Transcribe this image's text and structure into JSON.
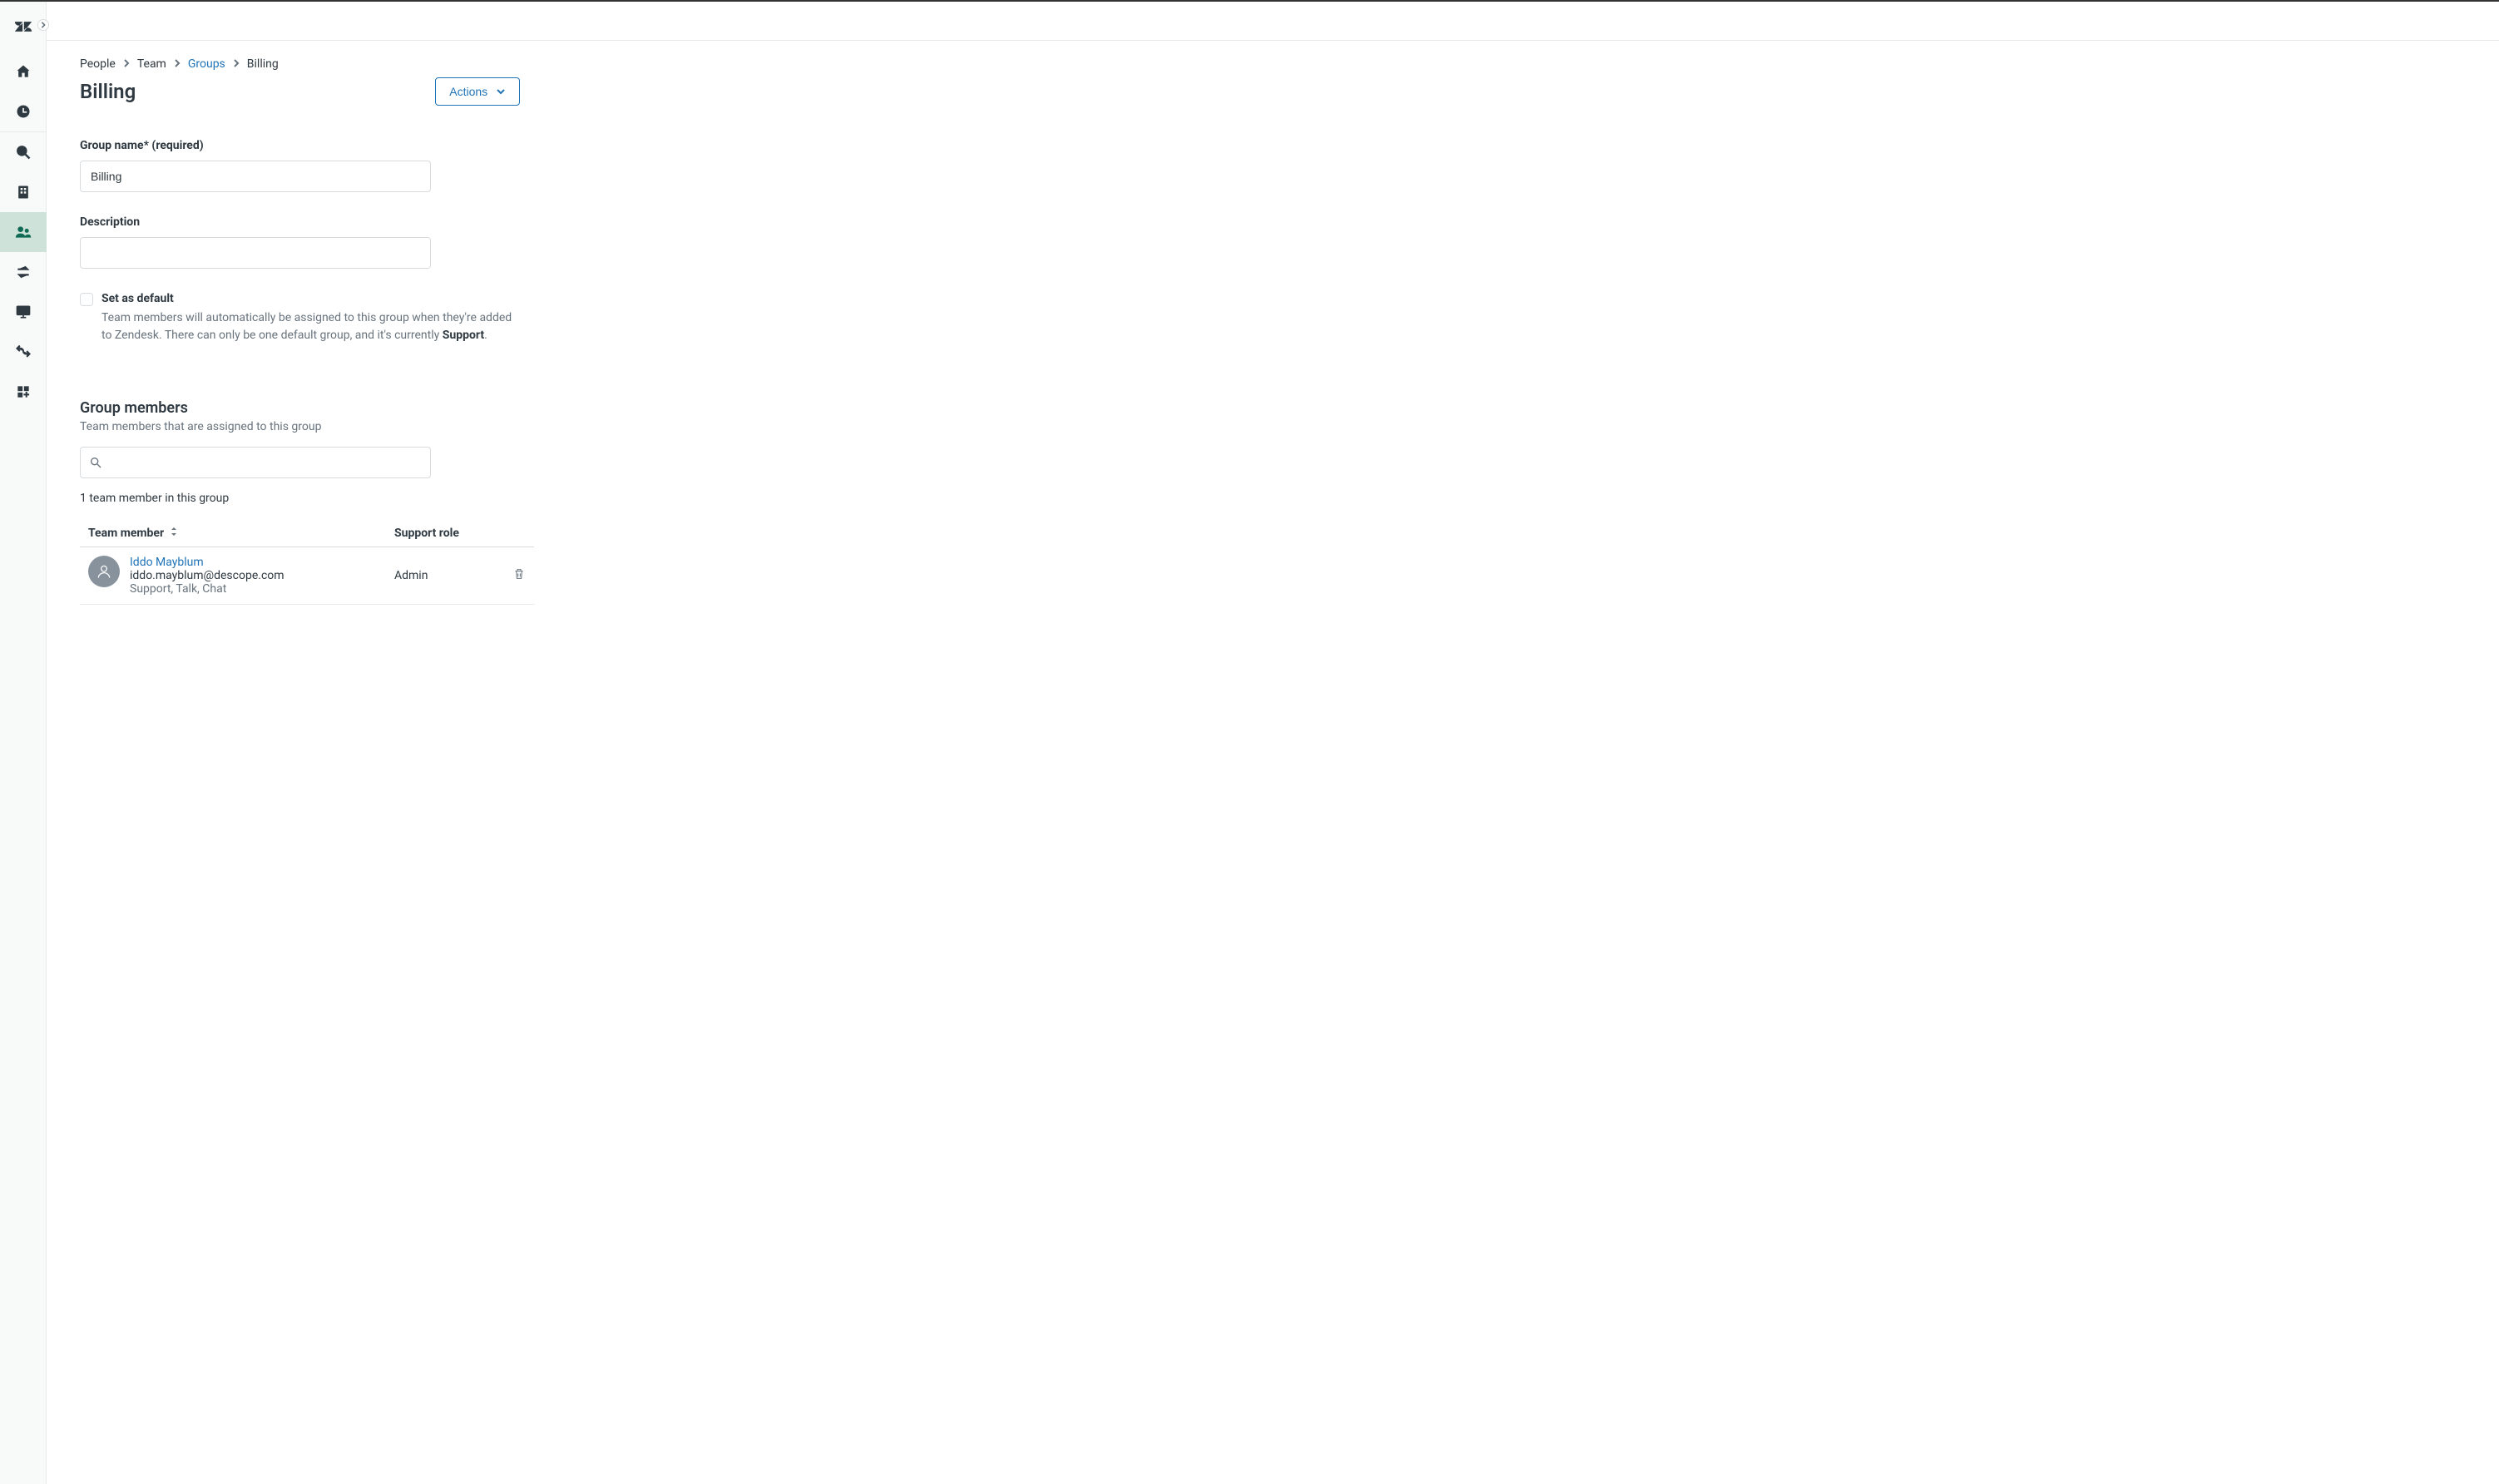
{
  "breadcrumb": {
    "people": "People",
    "team": "Team",
    "groups": "Groups",
    "current": "Billing"
  },
  "header": {
    "title": "Billing",
    "actions_label": "Actions"
  },
  "form": {
    "name_label": "Group name* (required)",
    "name_value": "Billing",
    "description_label": "Description",
    "description_value": "",
    "default_label": "Set as default",
    "default_help_prefix": "Team members will automatically be assigned to this group when they're added to Zendesk. There can only be one default group, and it's currently ",
    "default_help_strong": "Support",
    "default_help_suffix": "."
  },
  "members": {
    "section_title": "Group members",
    "section_subtitle": "Team members that are assigned to this group",
    "count_text": "1 team member in this group",
    "col_member": "Team member",
    "col_role": "Support role",
    "rows": [
      {
        "name": "Iddo Mayblum",
        "email": "iddo.mayblum@descope.com",
        "products": "Support, Talk, Chat",
        "role": "Admin"
      }
    ]
  },
  "sidebar_icons": [
    "home-icon",
    "recent-icon",
    "search-icon",
    "office-icon",
    "people-icon",
    "transfer-icon",
    "monitor-icon",
    "route-icon",
    "apps-icon"
  ]
}
